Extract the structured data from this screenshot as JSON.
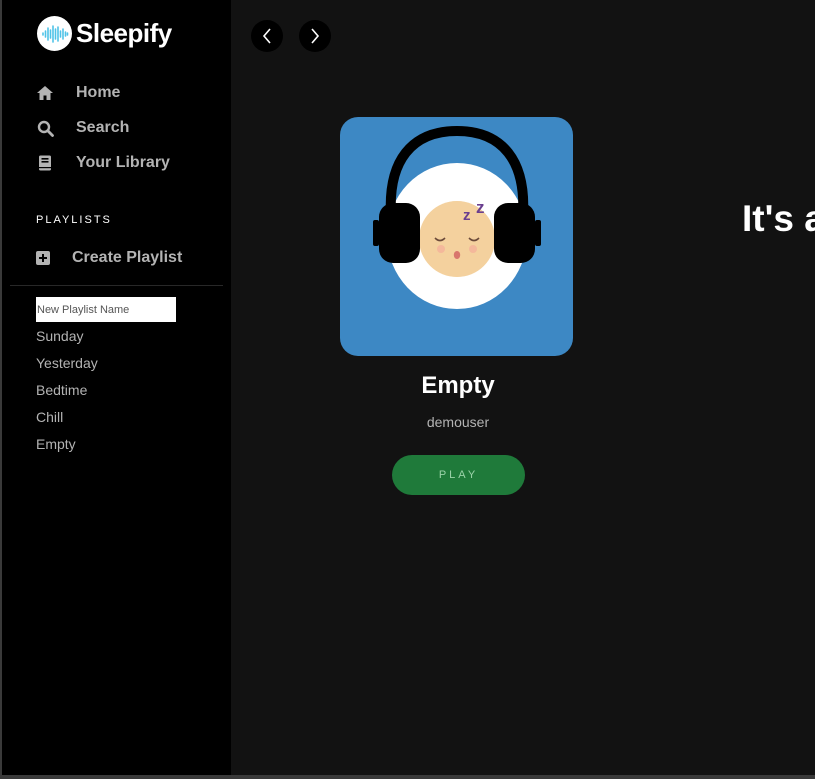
{
  "app": {
    "name": "Sleepify",
    "icon": "soundwave-logo-icon",
    "accent_color": "#1db954"
  },
  "sidebar": {
    "nav": [
      {
        "label": "Home",
        "icon": "home-icon"
      },
      {
        "label": "Search",
        "icon": "search-icon"
      },
      {
        "label": "Your Library",
        "icon": "library-book-icon"
      }
    ],
    "playlists_heading": "PLAYLISTS",
    "create_playlist": {
      "label": "Create Playlist",
      "icon": "plus-square-icon"
    },
    "new_playlist_input": {
      "value": "",
      "placeholder": "New Playlist Name"
    },
    "playlists": [
      "Sunday",
      "Yesterday",
      "Bedtime",
      "Chill",
      "Empty"
    ]
  },
  "header": {
    "back_icon": "chevron-left-icon",
    "forward_icon": "chevron-right-icon"
  },
  "playlist": {
    "title": "Empty",
    "owner": "demouser",
    "play_label": "PLAY",
    "cover_icon": "sleeping-face-headphones-icon",
    "cover_color": "#3d88c4"
  },
  "main": {
    "headline": "It's a"
  }
}
